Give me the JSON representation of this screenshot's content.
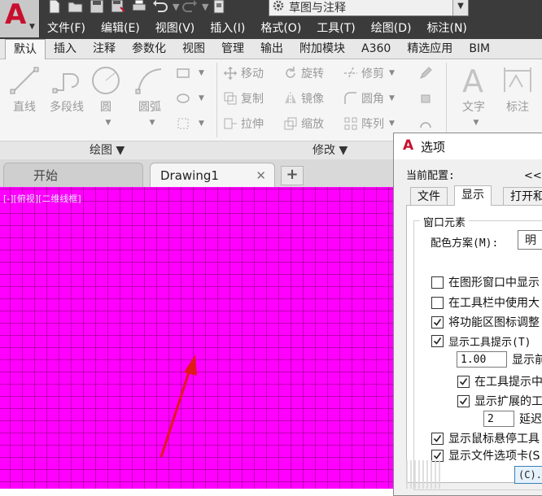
{
  "app": {
    "workspace": "草图与注释",
    "menu": [
      "文件(F)",
      "编辑(E)",
      "视图(V)",
      "插入(I)",
      "格式(O)",
      "工具(T)",
      "绘图(D)",
      "标注(N)"
    ]
  },
  "ribbon_tabs": [
    "默认",
    "插入",
    "注释",
    "参数化",
    "视图",
    "管理",
    "输出",
    "附加模块",
    "A360",
    "精选应用",
    "BIM"
  ],
  "ribbon": {
    "draw": {
      "line": "直线",
      "polyline": "多段线",
      "circle": "圆",
      "arc": "圆弧",
      "panel_title": "绘图 ▼"
    },
    "modify": {
      "move": "移动",
      "rotate": "旋转",
      "trim": "修剪",
      "copy": "复制",
      "mirror": "镜像",
      "fillet": "圆角",
      "stretch": "拉伸",
      "scale": "缩放",
      "array": "阵列",
      "panel_title": "修改 ▼"
    },
    "annotation": {
      "text": "文字",
      "dimension": "标注"
    }
  },
  "file_tabs": {
    "start": "开始",
    "drawing": "Drawing1",
    "close_glyph": "✕",
    "add_glyph": "+"
  },
  "canvas": {
    "viewport_label": "[-][俯视][二维线框]",
    "background_color": "#ff00ff"
  },
  "dialog": {
    "title": "选项",
    "current_profile_label": "当前配置:",
    "current_profile_value": "<<未",
    "tabs": [
      "文件",
      "显示",
      "打开和"
    ],
    "active_tab": "显示",
    "group_title": "窗口元素",
    "color_scheme_label": "配色方案(M):",
    "color_scheme_value": "明",
    "options": [
      {
        "label": "在图形窗口中显示",
        "checked": false
      },
      {
        "label": "在工具栏中使用大",
        "checked": false
      },
      {
        "label": "将功能区图标调整",
        "checked": true
      },
      {
        "label": "显示工具提示(T)",
        "checked": true
      }
    ],
    "tooltip_delay_value": "1.00",
    "tooltip_delay_label": "显示前",
    "sub_options": [
      {
        "label": "在工具提示中",
        "checked": true
      },
      {
        "label": "显示扩展的工",
        "checked": true
      }
    ],
    "extended_delay_value": "2",
    "extended_delay_label": "延迟",
    "rollover_label": "显示鼠标悬停工具",
    "rollover_checked": true,
    "file_tabs_label": "显示文件选项卡(S",
    "file_tabs_checked": true,
    "bottom_button": "(C)."
  }
}
